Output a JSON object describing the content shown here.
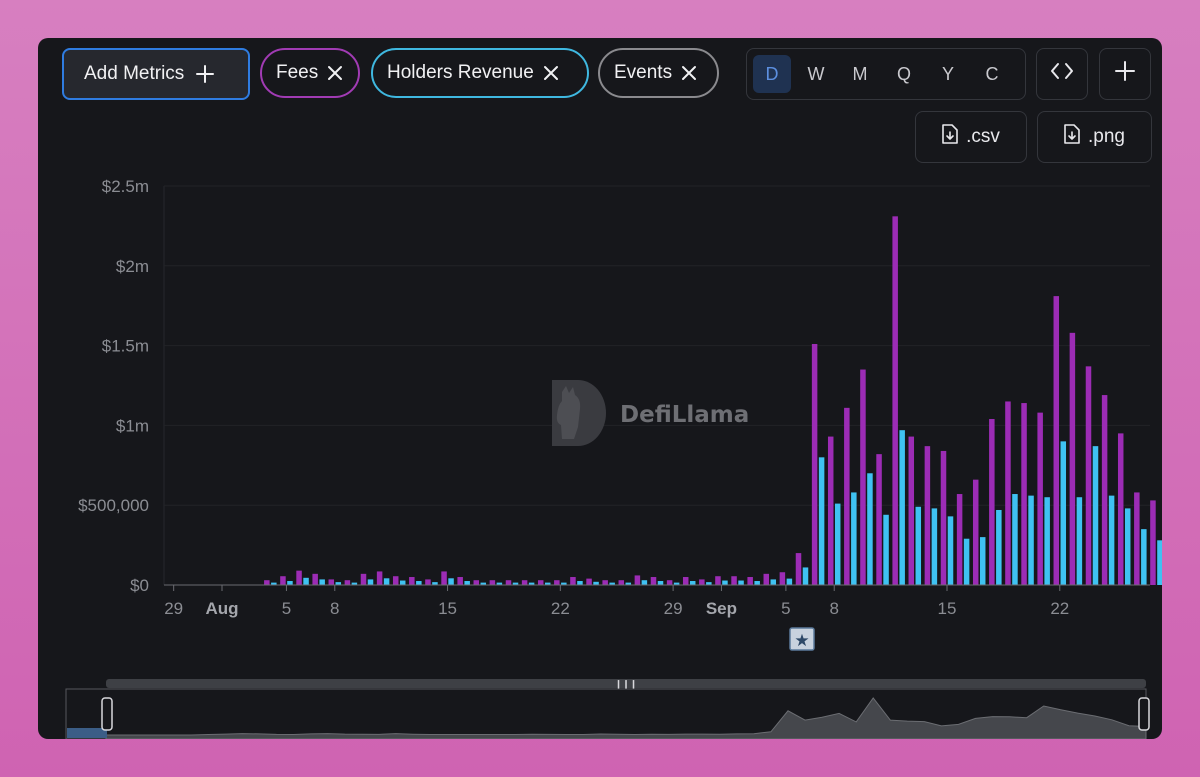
{
  "toolbar": {
    "add_metrics_label": "Add Metrics",
    "metric_pills": [
      {
        "label": "Fees",
        "border": "#a13bb4"
      },
      {
        "label": "Holders Revenue",
        "border": "#3fb8e0"
      },
      {
        "label": "Events",
        "border": "#8a8a8e"
      }
    ],
    "group_by": [
      "D",
      "W",
      "M",
      "Q",
      "Y",
      "C"
    ],
    "group_by_selected": "D",
    "csv_label": ".csv",
    "png_label": ".png"
  },
  "watermark": "DefiLlama",
  "colors": {
    "fees": "#9c2cb5",
    "holders_revenue": "#3fc2f2",
    "event_marker": "#5b7a9c",
    "brush_area": "#45474c"
  },
  "event_marker_icon": "star-icon",
  "chart_data": {
    "type": "bar",
    "x_tick_labels": [
      {
        "label": "29",
        "bold": false,
        "day": 0
      },
      {
        "label": "Aug",
        "bold": true,
        "day": 3
      },
      {
        "label": "5",
        "bold": false,
        "day": 7
      },
      {
        "label": "8",
        "bold": false,
        "day": 10
      },
      {
        "label": "15",
        "bold": false,
        "day": 17
      },
      {
        "label": "22",
        "bold": false,
        "day": 24
      },
      {
        "label": "29",
        "bold": false,
        "day": 31
      },
      {
        "label": "Sep",
        "bold": true,
        "day": 34
      },
      {
        "label": "5",
        "bold": false,
        "day": 38
      },
      {
        "label": "8",
        "bold": false,
        "day": 41
      },
      {
        "label": "15",
        "bold": false,
        "day": 48
      },
      {
        "label": "22",
        "bold": false,
        "day": 55
      }
    ],
    "y_tick_labels": [
      "$0",
      "$500,000",
      "$1m",
      "$1.5m",
      "$2m",
      "$2.5m"
    ],
    "y_tick_values": [
      0,
      500000,
      1000000,
      1500000,
      2000000,
      2500000
    ],
    "ylim": [
      0,
      2500000
    ],
    "xlim": [
      -0.6,
      60.6
    ],
    "grid": true,
    "series": [
      {
        "name": "Fees",
        "values": [
          0,
          0,
          0,
          0,
          0,
          0,
          30000,
          55000,
          90000,
          70000,
          35000,
          30000,
          70000,
          85000,
          55000,
          50000,
          35000,
          85000,
          50000,
          30000,
          30000,
          30000,
          30000,
          30000,
          30000,
          50000,
          40000,
          30000,
          30000,
          60000,
          50000,
          30000,
          50000,
          35000,
          55000,
          55000,
          50000,
          70000,
          80000,
          200000,
          1510000,
          930000,
          1110000,
          1350000,
          820000,
          2310000,
          930000,
          870000,
          840000,
          570000,
          660000,
          1040000,
          1150000,
          1140000,
          1080000,
          1810000,
          1580000,
          1370000,
          1190000,
          950000,
          580000,
          530000
        ]
      },
      {
        "name": "Holders Revenue",
        "values": [
          0,
          0,
          0,
          0,
          0,
          0,
          15000,
          25000,
          45000,
          35000,
          18000,
          15000,
          35000,
          42000,
          28000,
          25000,
          18000,
          42000,
          25000,
          15000,
          15000,
          15000,
          15000,
          15000,
          15000,
          25000,
          20000,
          15000,
          15000,
          30000,
          25000,
          15000,
          25000,
          18000,
          28000,
          28000,
          25000,
          35000,
          40000,
          110000,
          800000,
          510000,
          580000,
          700000,
          440000,
          970000,
          490000,
          480000,
          430000,
          290000,
          300000,
          470000,
          570000,
          560000,
          550000,
          900000,
          550000,
          870000,
          560000,
          480000,
          350000,
          280000
        ]
      }
    ],
    "events": [
      {
        "day": 39
      }
    ]
  }
}
